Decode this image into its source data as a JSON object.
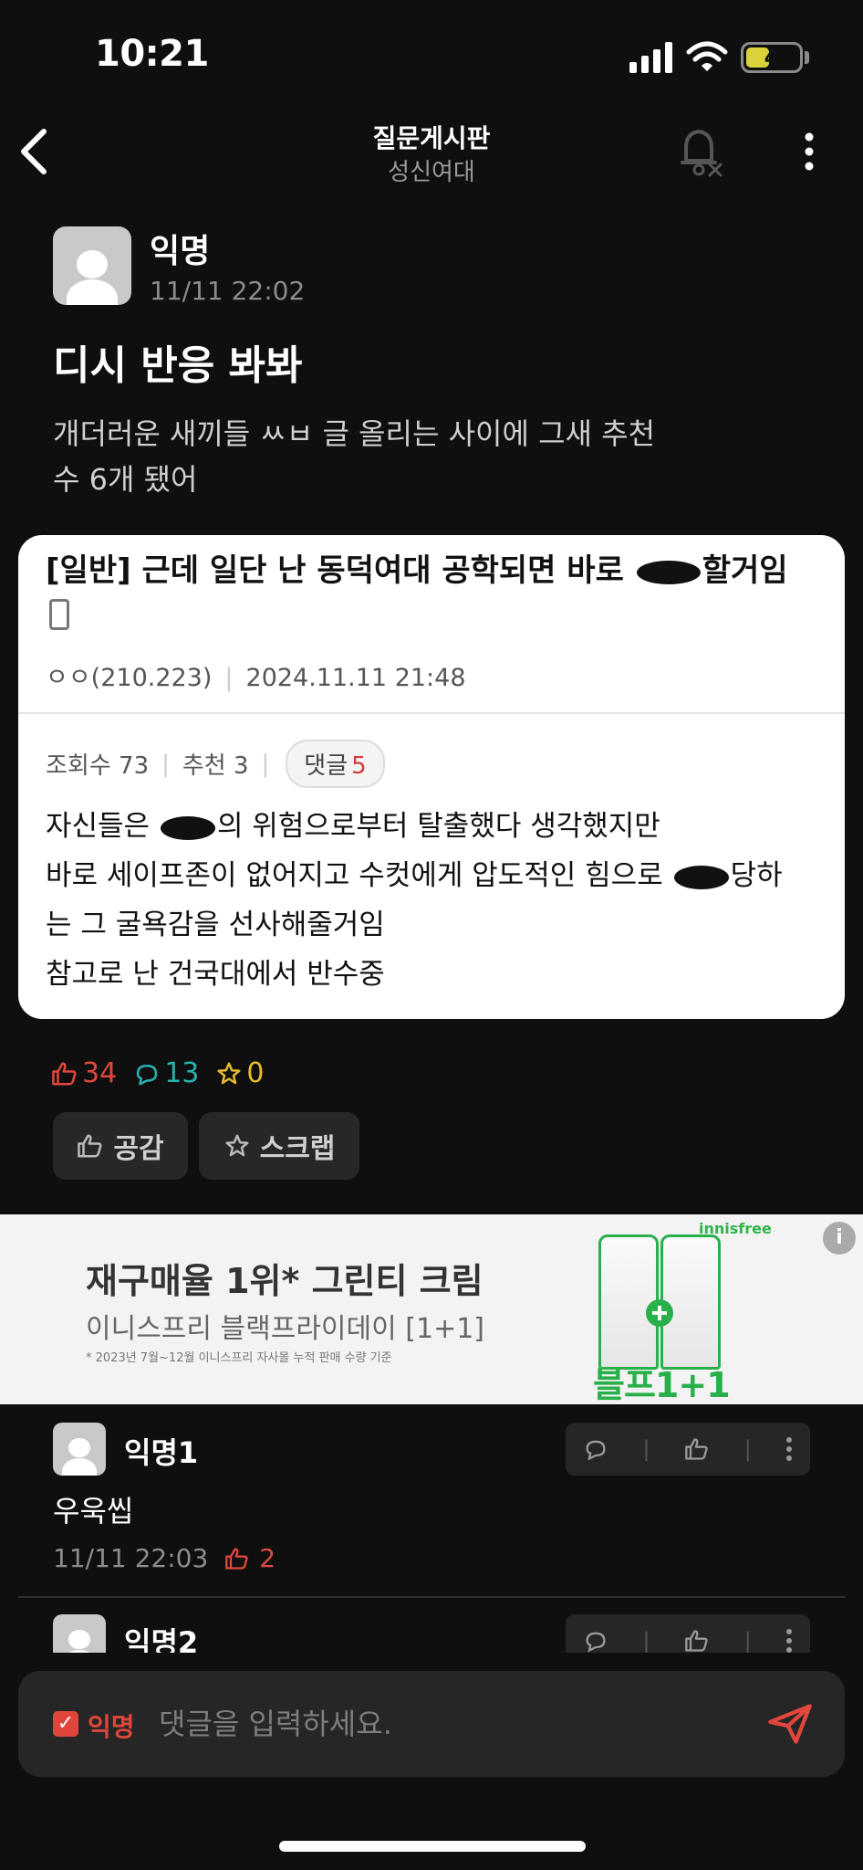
{
  "status_bar": {
    "time": "10:21",
    "battery": "4"
  },
  "header": {
    "title": "질문게시판",
    "subtitle": "성신여대"
  },
  "post": {
    "author": "익명",
    "date": "11/11 22:02",
    "title": "디시 반응 봐봐",
    "body_line1": "개더러운 새끼들 ㅆㅂ 글 올리는 사이에 그새 추천",
    "body_line2": "수 6개 됐어"
  },
  "embed": {
    "title_before": "[일반] 근데 일단 난 동덕여대 공학되면 바로 ",
    "title_after": "할거임",
    "author": "ㅇㅇ(210.223)",
    "datetime": "2024.11.11 21:48",
    "views": "조회수 73",
    "recommends": "추천 3",
    "comments_label": "댓글",
    "comments_count": "5",
    "line1_before": "자신들은 ",
    "line1_after": "의 위험으로부터 탈출했다 생각했지만",
    "line2_before": "바로 세이프존이 없어지고 수컷에게 압도적인 힘으로 ",
    "line2_after": "당하",
    "line3": "는 그 굴욕감을 선사해줄거임",
    "line4": "참고로 난 건국대에서 반수중"
  },
  "reactions": {
    "likes": "34",
    "comments": "13",
    "scraps": "0"
  },
  "actions": {
    "like_label": "공감",
    "scrap_label": "스크랩"
  },
  "ad": {
    "title": "재구매율 1위* 그린티 크림",
    "subtitle": "이니스프리 블랙프라이데이 [1+1]",
    "note": "* 2023년 7월~12월 이니스프리 자사몰 누적 판매 수량 기준",
    "brand": "innisfree",
    "badge": "블프1+1"
  },
  "comments": [
    {
      "author": "익명1",
      "body": "우욱씹",
      "date": "11/11 22:03",
      "likes": "2"
    },
    {
      "author": "익명2"
    }
  ],
  "input": {
    "anon_label": "익명",
    "placeholder": "댓글을 입력하세요."
  },
  "colors": {
    "accent_red": "#e0463c",
    "comment_teal": "#26b3b0",
    "scrap_yellow": "#e7b92e",
    "ad_green": "#29b04a"
  }
}
